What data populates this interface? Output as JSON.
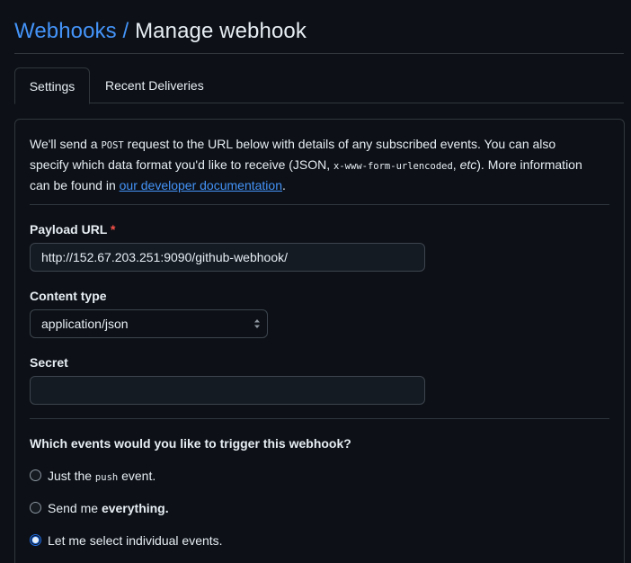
{
  "header": {
    "crumb_link": "Webhooks",
    "separator": " / ",
    "title": "Manage webhook"
  },
  "tabs": [
    {
      "label": "Settings",
      "active": true
    },
    {
      "label": "Recent Deliveries",
      "active": false
    }
  ],
  "intro": {
    "part1": "We'll send a ",
    "code1": "POST",
    "part2": " request to the URL below with details of any subscribed events. You can also specify which data format you'd like to receive (JSON, ",
    "code2": "x-www-form-urlencoded",
    "part3": ", ",
    "etc": "etc",
    "part4": "). More information can be found in ",
    "link": "our developer documentation",
    "part5": "."
  },
  "form": {
    "payload_label": "Payload URL",
    "required_mark": "*",
    "payload_value": "http://152.67.203.251:9090/github-webhook/",
    "content_type_label": "Content type",
    "content_type_value": "application/json",
    "secret_label": "Secret",
    "secret_value": ""
  },
  "events": {
    "question": "Which events would you like to trigger this webhook?",
    "options": [
      {
        "pre": "Just the ",
        "code": "push",
        "post": " event.",
        "checked": false
      },
      {
        "pre": "Send me ",
        "bold": "everything.",
        "checked": false
      },
      {
        "pre": "Let me select individual events.",
        "checked": true
      }
    ]
  },
  "colors": {
    "background": "#0d1117",
    "text": "#e6edf3",
    "link": "#4493f8",
    "border": "#30363d",
    "required": "#f85149",
    "radio_checked": "#1f6feb"
  }
}
